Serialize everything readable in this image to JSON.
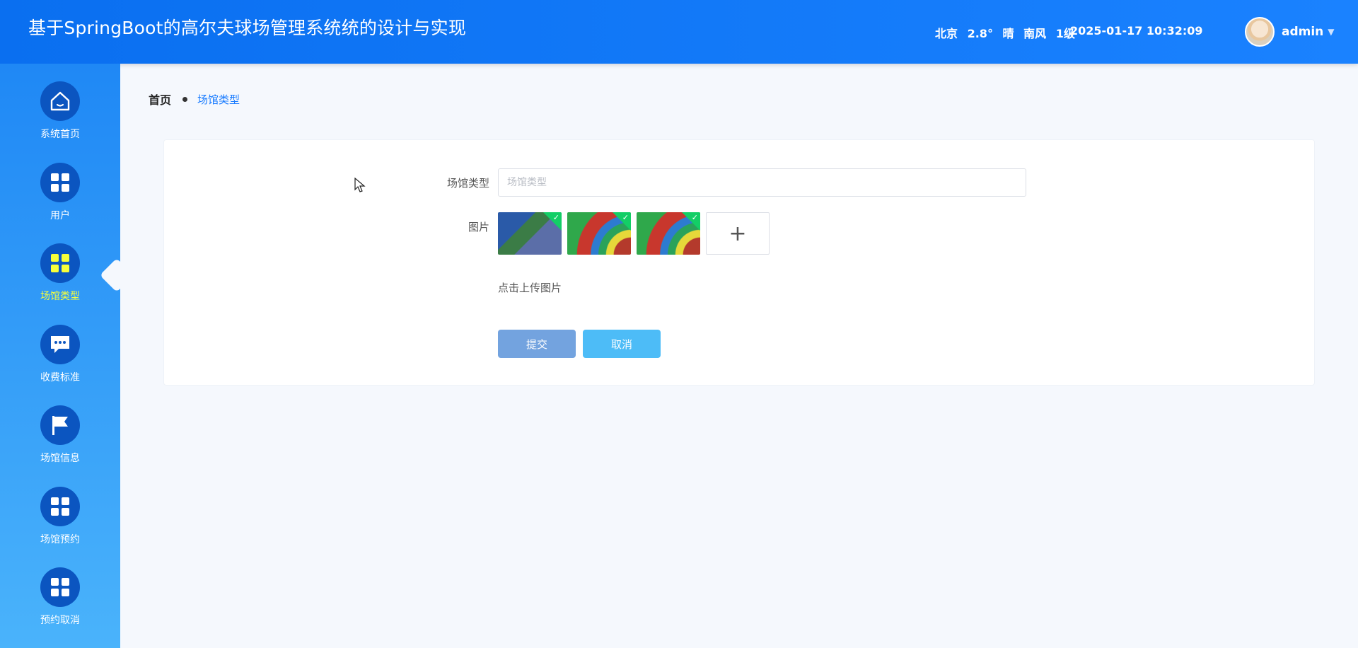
{
  "header": {
    "title": "基于SpringBoot的高尔夫球场管理系统统的设计与实现",
    "weather": {
      "city": "北京",
      "temp": "2.8°",
      "condition": "晴",
      "wind": "南风",
      "level": "1级"
    },
    "datetime": "2025-01-17 10:32:09",
    "user": {
      "name": "admin"
    }
  },
  "sidebar": {
    "items": [
      {
        "label": "系统首页",
        "icon": "home-icon"
      },
      {
        "label": "用户",
        "icon": "grid-icon"
      },
      {
        "label": "场馆类型",
        "icon": "grid-icon",
        "active": true
      },
      {
        "label": "收费标准",
        "icon": "chat-icon"
      },
      {
        "label": "场馆信息",
        "icon": "flag-icon"
      },
      {
        "label": "场馆预约",
        "icon": "grid-icon"
      },
      {
        "label": "预约取消",
        "icon": "grid-icon"
      }
    ]
  },
  "breadcrumb": {
    "home": "首页",
    "current": "场馆类型"
  },
  "form": {
    "type_label": "场馆类型",
    "type_placeholder": "场馆类型",
    "image_label": "图片",
    "upload_hint": "点击上传图片",
    "submit": "提交",
    "cancel": "取消"
  },
  "colors": {
    "primary": "#1a7cff",
    "sidebar_top": "#1f88f5",
    "active_label": "#f7ff3a",
    "submit": "#73a3df",
    "cancel": "#4dbcf7"
  }
}
